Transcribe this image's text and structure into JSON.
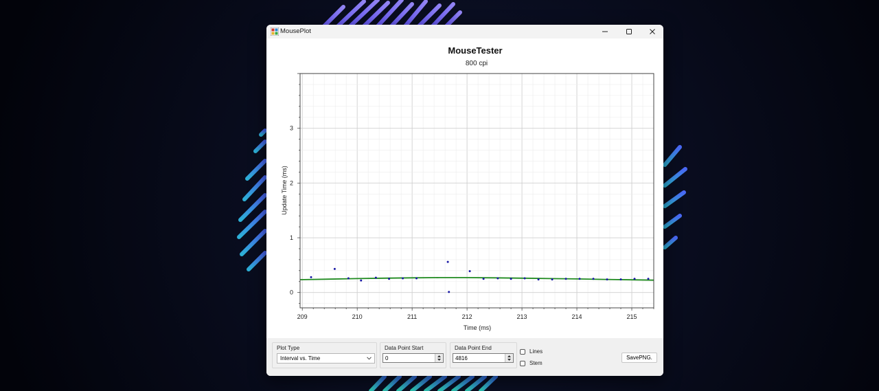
{
  "window": {
    "title": "MousePlot",
    "controls": [
      "minimize-icon",
      "maximize-icon",
      "close-icon"
    ]
  },
  "chart_data": {
    "type": "scatter",
    "title": "MouseTester",
    "subtitle": "800 cpi",
    "xlabel": "Time (ms)",
    "ylabel": "Update Time (ms)",
    "xlim": [
      208.96,
      215.4
    ],
    "ylim": [
      -0.28,
      4.0
    ],
    "xticks": [
      209,
      210,
      211,
      212,
      213,
      214,
      215
    ],
    "yticks": [
      0,
      1,
      2,
      3
    ],
    "grid": true,
    "point_color": "#1a1aa6",
    "trend_color": "#1f8a1f",
    "series": [
      {
        "x": [
          209.16,
          209.59,
          209.84,
          210.07,
          210.34,
          210.58,
          210.83,
          211.08,
          211.65,
          211.67,
          212.05,
          212.3,
          212.56,
          212.8,
          213.05,
          213.3,
          213.55,
          213.8,
          214.05,
          214.3,
          214.55,
          214.8,
          215.05,
          215.3
        ],
        "y": [
          0.28,
          0.43,
          0.26,
          0.22,
          0.27,
          0.25,
          0.26,
          0.26,
          0.56,
          0.01,
          0.39,
          0.25,
          0.26,
          0.25,
          0.26,
          0.24,
          0.24,
          0.25,
          0.25,
          0.25,
          0.24,
          0.24,
          0.25,
          0.25
        ]
      }
    ],
    "trend": {
      "x": [
        208.96,
        209.5,
        210.0,
        210.5,
        211.0,
        211.5,
        212.0,
        212.5,
        213.0,
        213.5,
        214.0,
        214.5,
        215.0,
        215.4
      ],
      "y": [
        0.235,
        0.245,
        0.255,
        0.262,
        0.268,
        0.272,
        0.272,
        0.268,
        0.262,
        0.255,
        0.248,
        0.24,
        0.232,
        0.226
      ]
    }
  },
  "controls": {
    "plot_type_label": "Plot Type",
    "plot_type_value": "Interval vs. Time",
    "start_label": "Data Point Start",
    "start_value": "0",
    "end_label": "Data Point End",
    "end_value": "4816",
    "lines_label": "Lines",
    "stem_label": "Stem",
    "save_label": "SavePNG."
  }
}
